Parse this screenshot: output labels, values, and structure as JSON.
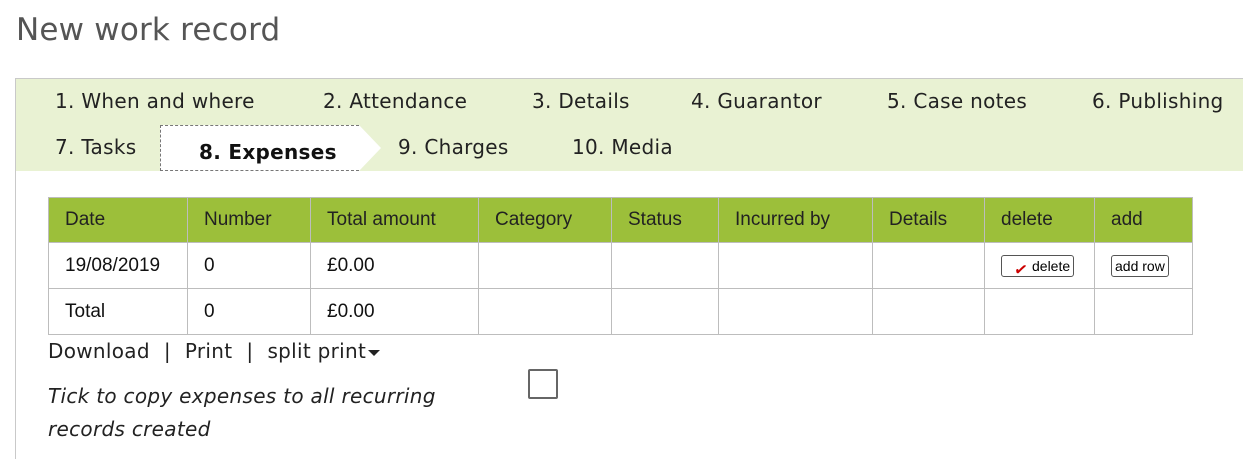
{
  "page_title": "New work record",
  "tabs": [
    {
      "label": "1. When and where"
    },
    {
      "label": "2. Attendance"
    },
    {
      "label": "3. Details"
    },
    {
      "label": "4. Guarantor"
    },
    {
      "label": "5. Case notes"
    },
    {
      "label": "6. Publishing"
    },
    {
      "label": "7. Tasks"
    },
    {
      "label": "8. Expenses",
      "active": true
    },
    {
      "label": "9. Charges"
    },
    {
      "label": "10. Media"
    }
  ],
  "table": {
    "headers": [
      "Date",
      "Number",
      "Total amount",
      "Category",
      "Status",
      "Incurred by",
      "Details",
      "delete",
      "add"
    ],
    "rows": [
      {
        "date": "19/08/2019",
        "number": "0",
        "total_amount": "£0.00",
        "category": "",
        "status": "",
        "incurred_by": "",
        "details": "",
        "delete_label": "delete",
        "add_label": "add row"
      }
    ],
    "total_row": {
      "label": "Total",
      "number": "0",
      "total_amount": "£0.00"
    }
  },
  "links": {
    "download": "Download",
    "separator": "|",
    "print": "Print",
    "split_print": "split print"
  },
  "copy_option": {
    "label": "Tick to copy expenses to all recurring records created",
    "checked": false
  },
  "colors": {
    "tab_bar_bg": "#e9f2d3",
    "table_header_bg": "#9cbf3a",
    "delete_mark": "#cc0000"
  }
}
